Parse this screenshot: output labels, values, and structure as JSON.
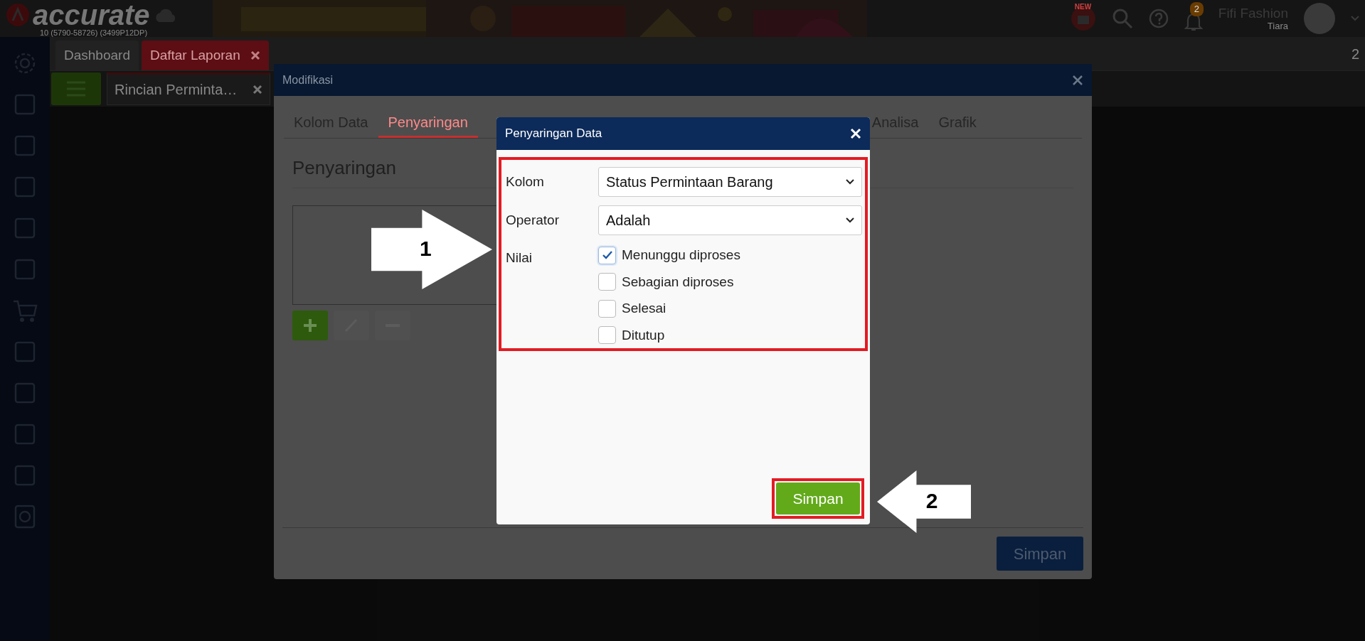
{
  "app_header": {
    "logo_text": "accurate",
    "build_info": "10 (5790-58726) (3499P12DP)",
    "new_badge": "NEW",
    "notification_count": "2",
    "company": "Fifi Fashion",
    "user": "Tiara"
  },
  "main_tabs": [
    {
      "label": "Dashboard",
      "selected": false,
      "closable": false
    },
    {
      "label": "Daftar Laporan",
      "selected": true,
      "closable": true
    }
  ],
  "tab_counter": "2",
  "sub_tabs": [
    {
      "label": "Rincian Perminta…",
      "closable": true
    }
  ],
  "modal": {
    "title": "Modifikasi",
    "tabs": [
      {
        "label": "Kolom Data",
        "selected": false
      },
      {
        "label": "Penyaringan",
        "selected": true
      },
      {
        "label": "Analisa",
        "selected": false
      },
      {
        "label": "Grafik",
        "selected": false
      }
    ],
    "section_title": "Penyaringan",
    "toolbar": [
      {
        "kind": "add",
        "disabled": false
      },
      {
        "kind": "edit",
        "disabled": true
      },
      {
        "kind": "remove",
        "disabled": true
      }
    ],
    "save_button": "Simpan"
  },
  "dialog": {
    "title": "Penyaringan Data",
    "fields": [
      {
        "label": "Kolom",
        "kind": "select",
        "value": "Status Permintaan Barang"
      },
      {
        "label": "Operator",
        "kind": "select",
        "value": "Adalah"
      },
      {
        "label": "Nilai",
        "kind": "checklist",
        "options": [
          {
            "label": "Menunggu diproses",
            "checked": true
          },
          {
            "label": "Sebagian diproses",
            "checked": false
          },
          {
            "label": "Selesai",
            "checked": false
          },
          {
            "label": "Ditutup",
            "checked": false
          }
        ]
      }
    ],
    "save_button": "Simpan"
  },
  "annotations": [
    {
      "label": "1"
    },
    {
      "label": "2"
    }
  ]
}
